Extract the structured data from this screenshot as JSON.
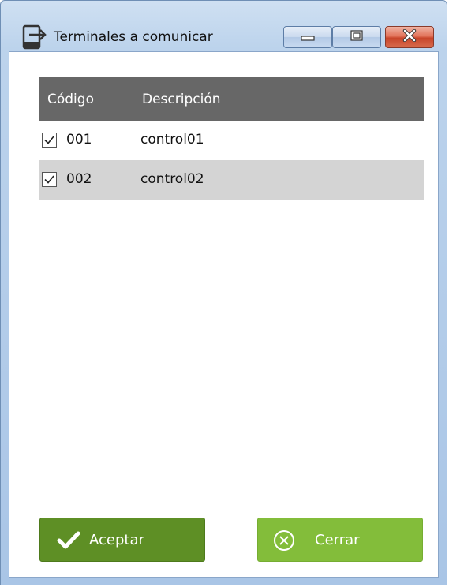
{
  "window": {
    "title": "Terminales a comunicar",
    "controls": {
      "minimize": "minimize",
      "maximize": "maximize",
      "close": "close"
    }
  },
  "grid": {
    "columns": {
      "code": "Código",
      "description": "Descripción"
    },
    "rows": [
      {
        "checked": true,
        "code": "001",
        "description": "control01"
      },
      {
        "checked": true,
        "code": "002",
        "description": "control02"
      }
    ]
  },
  "buttons": {
    "accept": "Aceptar",
    "close": "Cerrar"
  },
  "colors": {
    "header_bg": "#676767",
    "row_alt_bg": "#d4d4d4",
    "accept_bg": "#5e8f25",
    "close_bg": "#83bd3a"
  }
}
